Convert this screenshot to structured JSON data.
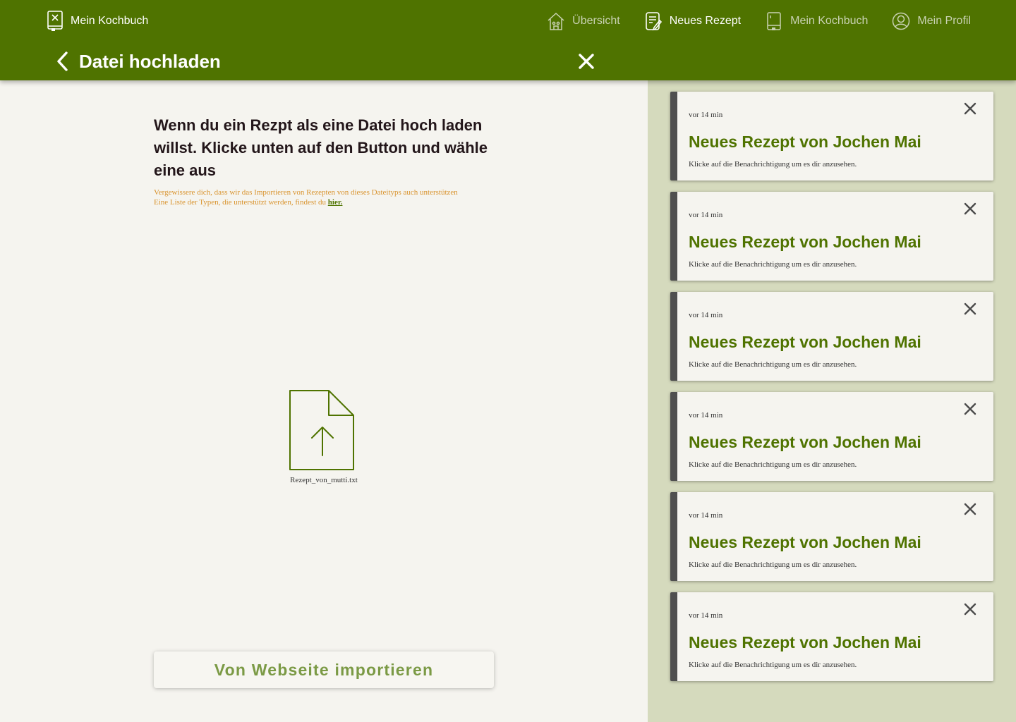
{
  "app": {
    "brand_label": "Mein Kochbuch"
  },
  "nav": {
    "items": [
      {
        "label": "Übersicht",
        "icon": "home-icon",
        "active": false
      },
      {
        "label": "Neues Rezept",
        "icon": "new-recipe-icon",
        "active": true
      },
      {
        "label": "Mein Kochbuch",
        "icon": "cookbook-icon",
        "active": false
      },
      {
        "label": "Mein Profil",
        "icon": "profile-icon",
        "active": false
      }
    ]
  },
  "page": {
    "title": "Datei hochladen"
  },
  "upload": {
    "heading": "Wenn du ein Rezpt als eine Datei hoch laden willst. Klicke unten auf den Button und wähle eine aus",
    "hint_line1": "Vergewissere dich, dass wir das Importieren von Rezepten von dieses Dateityps auch unterstützen",
    "hint_line2": "Eine Liste der Typen, die unterstützt werden, findest du ",
    "hint_link": "hier.",
    "file_name": "Rezept_von_mutti.txt",
    "import_button": "Von Webseite importieren"
  },
  "notifications": [
    {
      "time": "vor 14 min",
      "title": "Neues Rezept von Jochen Mai",
      "text": "Klicke auf die Benachrichtigung um es dir anzusehen."
    },
    {
      "time": "vor 14 min",
      "title": "Neues Rezept von Jochen Mai",
      "text": "Klicke auf die Benachrichtigung um es dir anzusehen."
    },
    {
      "time": "vor 14 min",
      "title": "Neues Rezept von Jochen Mai",
      "text": "Klicke auf die Benachrichtigung um es dir anzusehen."
    },
    {
      "time": "vor 14 min",
      "title": "Neues Rezept von Jochen Mai",
      "text": "Klicke auf die Benachrichtigung um es dir anzusehen."
    },
    {
      "time": "vor 14 min",
      "title": "Neues Rezept von Jochen Mai",
      "text": "Klicke auf die Benachrichtigung um es dir anzusehen."
    },
    {
      "time": "vor 14 min",
      "title": "Neues Rezept von Jochen Mai",
      "text": "Klicke auf die Benachrichtigung um es dir anzusehen."
    }
  ],
  "colors": {
    "header": "#4f7300",
    "accent": "#4f7300",
    "hint": "#d9932d",
    "side_panel": "#d5dabd",
    "background": "#f5f4ef",
    "notification_bar": "#4f4f4f"
  }
}
